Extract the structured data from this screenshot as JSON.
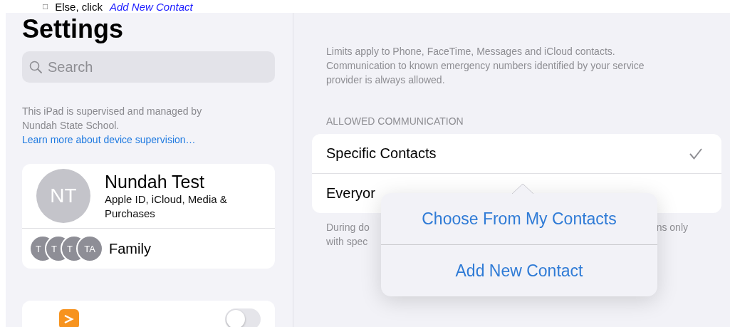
{
  "document_line": {
    "checkbox_glyph": "□",
    "text": "Else, click",
    "link": "Add New Contact"
  },
  "sidebar": {
    "title": "Settings",
    "search": {
      "placeholder": "Search"
    },
    "supervision_note": {
      "text": "This iPad is supervised and managed by Nundah State School.",
      "link": "Learn more about device supervision…"
    },
    "account": {
      "initials": "NT",
      "name": "Nundah Test",
      "subtitle": "Apple ID, iCloud, Media & Purchases",
      "family_label": "Family",
      "family_avatars": [
        "T",
        "T",
        "T",
        "TA"
      ]
    },
    "settings_rows": [
      {
        "kind": "toggle",
        "on": false
      }
    ]
  },
  "detail": {
    "note": "Limits apply to Phone, FaceTime, Messages and iCloud contacts. Communication to known emergency numbers identified by your service provider is always allowed.",
    "section_header": "ALLOWED COMMUNICATION",
    "options": [
      {
        "label": "Specific Contacts",
        "selected": true
      },
      {
        "label": "Everyor",
        "selected": false
      }
    ],
    "footer": {
      "line_1_start": "During do",
      "line_1_end": "ns only",
      "line_2_start": "with spec"
    }
  },
  "popover": {
    "items": [
      "Choose From My Contacts",
      "Add New Contact"
    ]
  }
}
